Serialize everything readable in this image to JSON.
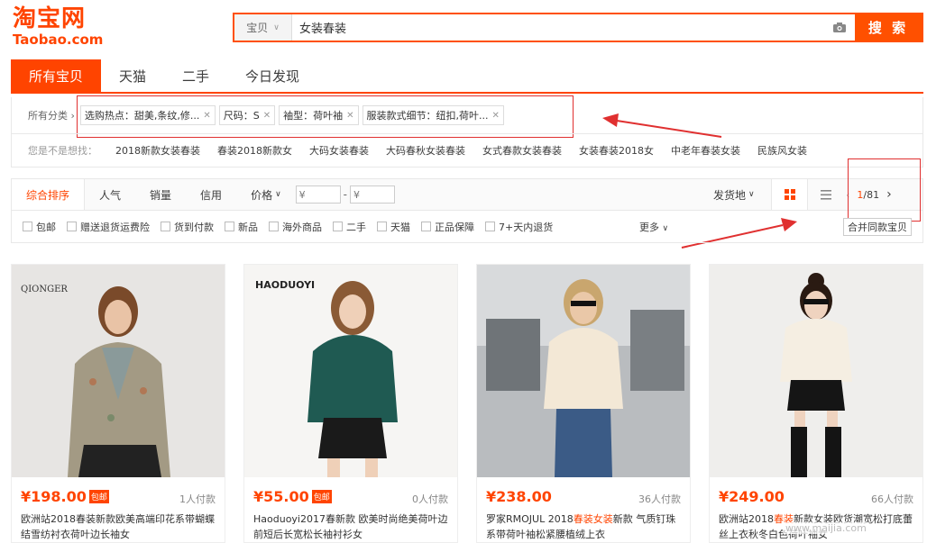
{
  "logo": {
    "cn": "淘宝网",
    "en": "Taobao.com"
  },
  "search": {
    "category": "宝贝",
    "query": "女装春装",
    "button": "搜 索"
  },
  "tabs": [
    {
      "label": "所有宝贝",
      "active": true
    },
    {
      "label": "天猫",
      "active": false
    },
    {
      "label": "二手",
      "active": false
    },
    {
      "label": "今日发现",
      "active": false
    }
  ],
  "crumbs": {
    "label": "所有分类",
    "chips": [
      "选购热点：甜美,条纹,修...",
      "尺码：S",
      "袖型：荷叶袖",
      "服装款式细节：纽扣,荷叶..."
    ]
  },
  "suggest": {
    "label": "您是不是想找：",
    "items": [
      "2018新款女装春装",
      "春装2018新款女",
      "大码女装春装",
      "大码春秋女装春装",
      "女式春款女装春装",
      "女装春装2018女",
      "中老年春装女装",
      "民族风女装"
    ]
  },
  "sort": {
    "items": [
      "综合排序",
      "人气",
      "销量",
      "信用",
      "价格"
    ],
    "price_min_placeholder": "¥",
    "price_max_placeholder": "¥",
    "ship_from": "发货地",
    "page_current": "1",
    "page_total": "/81"
  },
  "options": {
    "items": [
      "包邮",
      "赠送退货运费险",
      "货到付款",
      "新品",
      "海外商品",
      "二手",
      "天猫",
      "正品保障",
      "7+天内退货"
    ],
    "more": "更多",
    "merge": "合并同款宝贝"
  },
  "products": [
    {
      "price": "¥198.00",
      "badge": "包邮",
      "paid": "1人付款",
      "title": "欧洲站2018春装新款欧美高端印花系带蝴蝶结雪纺衬衣荷叶边长袖女",
      "brand": "QIONGER"
    },
    {
      "price": "¥55.00",
      "badge": "包邮",
      "paid": "0人付款",
      "title": "Haoduoyi2017春新款 欧美时尚绝美荷叶边前短后长宽松长袖衬衫女",
      "brand": "HAODUOYI"
    },
    {
      "price": "¥238.00",
      "badge": "",
      "paid": "36人付款",
      "title_a": "罗家RMOJUL 2018",
      "title_hl": "春装女装",
      "title_b": "新款 气质钉珠系带荷叶袖松紧腰植绒上衣"
    },
    {
      "price": "¥249.00",
      "badge": "",
      "paid": "66人付款",
      "title_a": "欧洲站2018",
      "title_hl": "春装",
      "title_b": "新款女装欧货潮宽松打底蕾丝上衣秋冬白色荷叶袖女"
    }
  ],
  "watermark": "www.maijia.com",
  "colors": {
    "accent": "#ff4400",
    "annotation": "#e03030"
  }
}
